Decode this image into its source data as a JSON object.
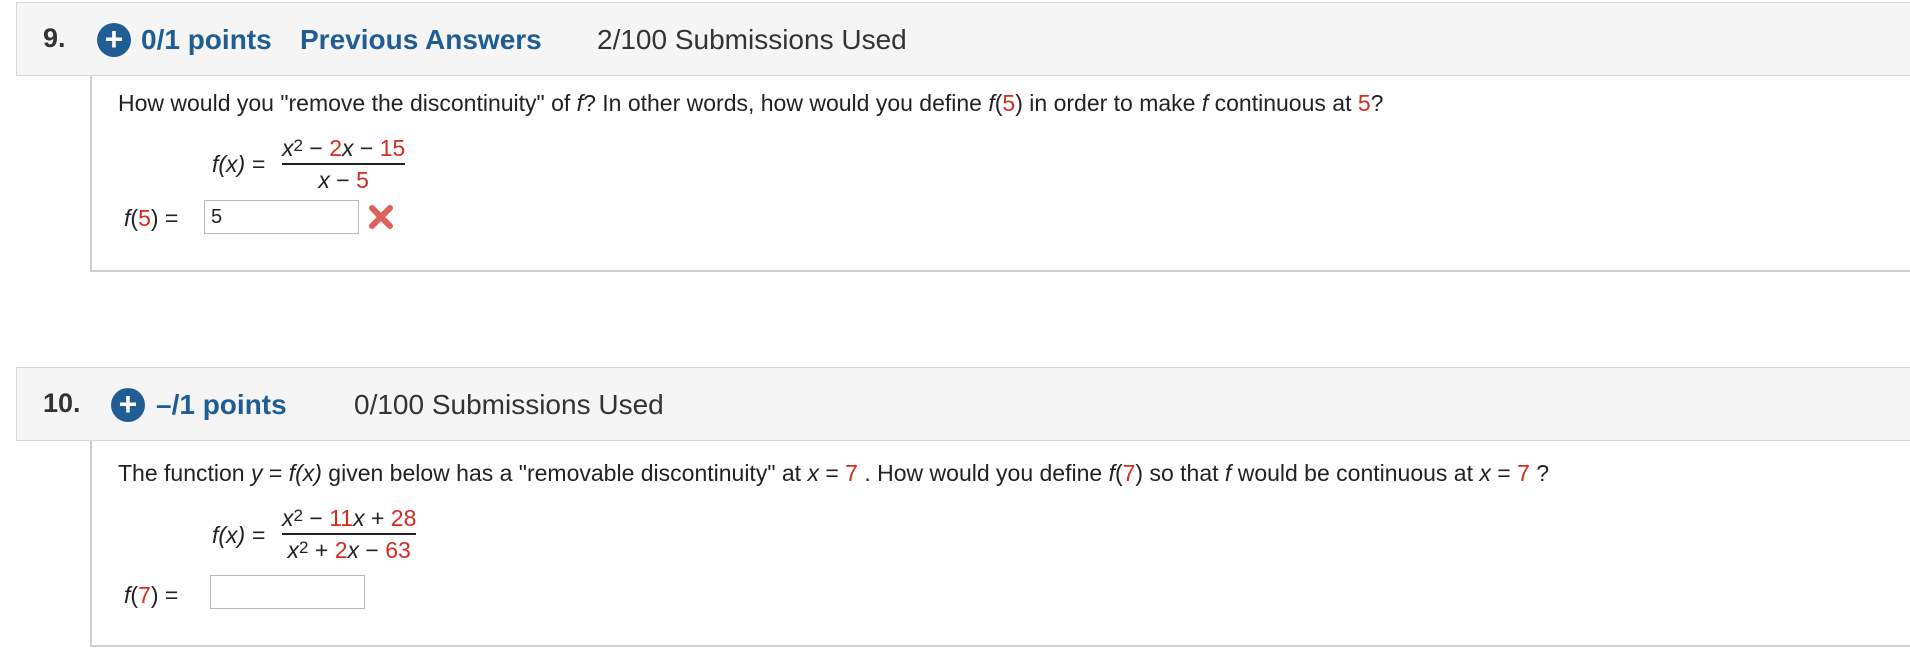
{
  "questions": [
    {
      "number": "9.",
      "points": "0/1 points",
      "previous_answers": "Previous Answers",
      "submissions": "2/100 Submissions Used",
      "prompt": {
        "p1": "How would you \"remove the discontinuity\" of ",
        "f": "f",
        "p2": "? In other words, how would you define ",
        "f_open": "f",
        "paren_open": "(",
        "arg": "5",
        "paren_close": ")",
        "p3": " in order to make ",
        "f2": "f",
        "p4": " continuous at ",
        "point": "5",
        "end": "?"
      },
      "formula": {
        "lhs": "f(x) =",
        "num_x": "x",
        "num_exp": "2",
        "num_mid": " − ",
        "num_coef": "2",
        "num_x2": "x",
        "num_op": " − ",
        "num_const": "15",
        "den_x": "x",
        "den_op": " − ",
        "den_const": "5"
      },
      "answer": {
        "label_f": "f",
        "label_open": "(",
        "label_arg": "5",
        "label_close": ") =",
        "value": "5",
        "status": "incorrect"
      }
    },
    {
      "number": "10.",
      "points": "–/1 points",
      "submissions": "0/100 Submissions Used",
      "prompt": {
        "p1": "The function ",
        "y": "y",
        "eq": " = ",
        "fx": "f(x)",
        "p2": " given below has a \"removable discontinuity\" at ",
        "x": "x",
        "eq2": " = ",
        "point": "7",
        "p3": " . How would you define ",
        "f": "f",
        "open": "(",
        "arg": "7",
        "close": ")",
        "p4": " so that ",
        "f2": "f",
        "p5": " would be continuous at ",
        "x2": "x",
        "eq3": " = ",
        "point2": "7",
        "end": " ?"
      },
      "formula": {
        "lhs": "f(x) =",
        "num_x": "x",
        "num_exp": "2",
        "num_op1": " − ",
        "num_coef": "11",
        "num_x2": "x",
        "num_op2": " + ",
        "num_const": "28",
        "den_x": "x",
        "den_exp": "2",
        "den_op1": " + ",
        "den_coef": "2",
        "den_x2": "x",
        "den_op2": " − ",
        "den_const": "63"
      },
      "answer": {
        "label_f": "f",
        "label_open": "(",
        "label_arg": "7",
        "label_close": ") =",
        "value": ""
      }
    }
  ],
  "icons": {
    "plus": "+",
    "incorrect": "x-mark-icon"
  },
  "colors": {
    "link_blue": "#1f5d93",
    "highlight_red": "#d62b1f",
    "incorrect_red": "#e0605b"
  }
}
